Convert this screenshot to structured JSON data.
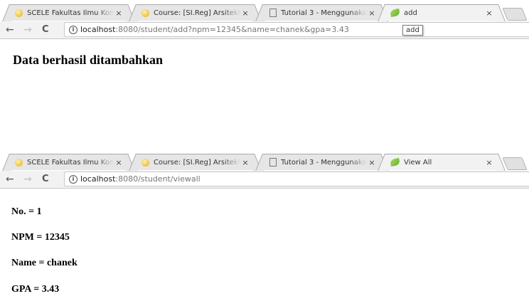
{
  "browser_top": {
    "tabs": [
      {
        "title": "SCELE Fakultas Ilmu Kom",
        "favicon": "ui-logo-icon",
        "close": "×"
      },
      {
        "title": "Course: [SI.Reg] Arsitektu",
        "favicon": "ui-logo-icon",
        "close": "×"
      },
      {
        "title": "Tutorial 3 - Menggunaka",
        "favicon": "document-icon",
        "close": "×"
      },
      {
        "title": "add",
        "favicon": "spring-leaf-icon",
        "close": "×"
      }
    ],
    "url_host": "localhost",
    "url_path": ":8080/student/add?npm=12345&name=chanek&gpa=3.43",
    "tooltip": "add"
  },
  "page_top": {
    "message": "Data berhasil ditambahkan"
  },
  "browser_bottom": {
    "tabs": [
      {
        "title": "SCELE Fakultas Ilmu Kom",
        "favicon": "ui-logo-icon",
        "close": "×"
      },
      {
        "title": "Course: [SI.Reg] Arsitektu",
        "favicon": "ui-logo-icon",
        "close": "×"
      },
      {
        "title": "Tutorial 3 - Menggunaka",
        "favicon": "document-icon",
        "close": "×"
      },
      {
        "title": "View All",
        "favicon": "spring-leaf-icon",
        "close": "×"
      }
    ],
    "url_host": "localhost",
    "url_path": ":8080/student/viewall"
  },
  "page_bottom": {
    "no": "No. = 1",
    "npm": "NPM = 12345",
    "name": "Name = chanek",
    "gpa": "GPA = 3.43"
  },
  "nav": {
    "back": "←",
    "forward": "→",
    "reload": "C",
    "info": "i"
  },
  "colors": {
    "tab_inactive": "#e6e6e6",
    "tab_active": "#f2f2f2",
    "toolbar": "#f2f2f2",
    "url_path": "#777777"
  }
}
